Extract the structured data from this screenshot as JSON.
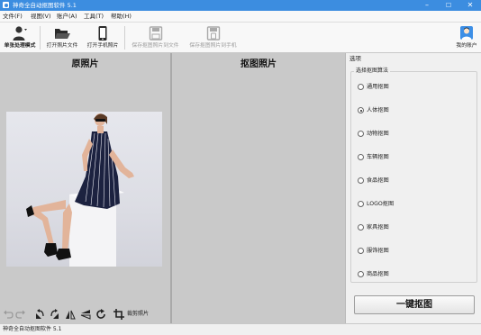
{
  "window": {
    "title": "神奇全自动抠图软件 5.1",
    "min": "–",
    "max": "☐",
    "close": "✕"
  },
  "menu": [
    "文件(F)",
    "视图(V)",
    "账户(A)",
    "工具(T)",
    "帮助(H)"
  ],
  "toolbar": {
    "single_mode": "单张处理模式",
    "open_photo_file": "打开照片文件",
    "open_phone_photo": "打开手机照片",
    "save_to_file": "保存抠图照片到文件",
    "save_to_phone": "保存抠图照片到手机",
    "account": "我的账户"
  },
  "panels": {
    "original_title": "原照片",
    "cutout_title": "抠图照片"
  },
  "bottom_tools": {
    "crop_label": "裁剪照片"
  },
  "options": {
    "header": "选项",
    "group_label": "选择抠图算法",
    "algorithms": [
      {
        "label": "通用抠图",
        "selected": false
      },
      {
        "label": "人体抠图",
        "selected": true
      },
      {
        "label": "动物抠图",
        "selected": false
      },
      {
        "label": "车辆抠图",
        "selected": false
      },
      {
        "label": "食品抠图",
        "selected": false
      },
      {
        "label": "LOGO抠图",
        "selected": false
      },
      {
        "label": "家具抠图",
        "selected": false
      },
      {
        "label": "服饰抠图",
        "selected": false
      },
      {
        "label": "商品抠图",
        "selected": false
      }
    ],
    "cutout_button": "一键抠图"
  },
  "status": {
    "text": "神奇全自动抠图软件 5.1"
  },
  "colors": {
    "titlebar": "#3c8de0",
    "panel_bg": "#c9c9c9",
    "dress": "#1c2240",
    "skin": "#e2b49a"
  },
  "icons": [
    "app-icon",
    "user-icon",
    "folder-open-icon",
    "phone-icon",
    "save-disk-icon",
    "save-phone-icon",
    "avatar-icon",
    "undo-icon",
    "redo-icon",
    "rotate-left-icon",
    "rotate-right-icon",
    "flip-horizontal-icon",
    "flip-vertical-icon",
    "refresh-icon",
    "crop-icon"
  ]
}
